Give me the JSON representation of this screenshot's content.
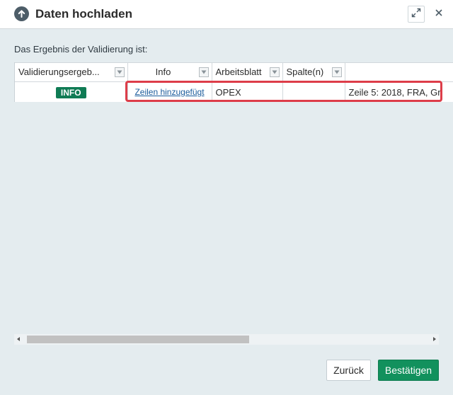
{
  "dialog": {
    "title": "Daten hochladen",
    "icons": {
      "title": "arrow-up-circle-icon",
      "expand": "expand-icon",
      "close": "close-icon"
    }
  },
  "subtitle": "Das Ergebnis der Validierung ist:",
  "table": {
    "columns": [
      {
        "label": "Validierungsergeb..."
      },
      {
        "label": "Info"
      },
      {
        "label": "Arbeitsblatt"
      },
      {
        "label": "Spalte(n)"
      },
      {
        "label": ""
      }
    ],
    "rows": [
      {
        "status": "INFO",
        "info": "Zeilen hinzugefügt",
        "sheet": "OPEX",
        "columns": "",
        "details": "Zeile 5: 2018, FRA, Gr"
      }
    ]
  },
  "scrollbar": {
    "position": 0
  },
  "buttons": {
    "back": "Zurück",
    "confirm": "Bestätigen"
  },
  "colors": {
    "badge": "#0f7b54",
    "confirm": "#12915d",
    "highlight": "#dd3d49",
    "link": "#1a5b9b"
  }
}
